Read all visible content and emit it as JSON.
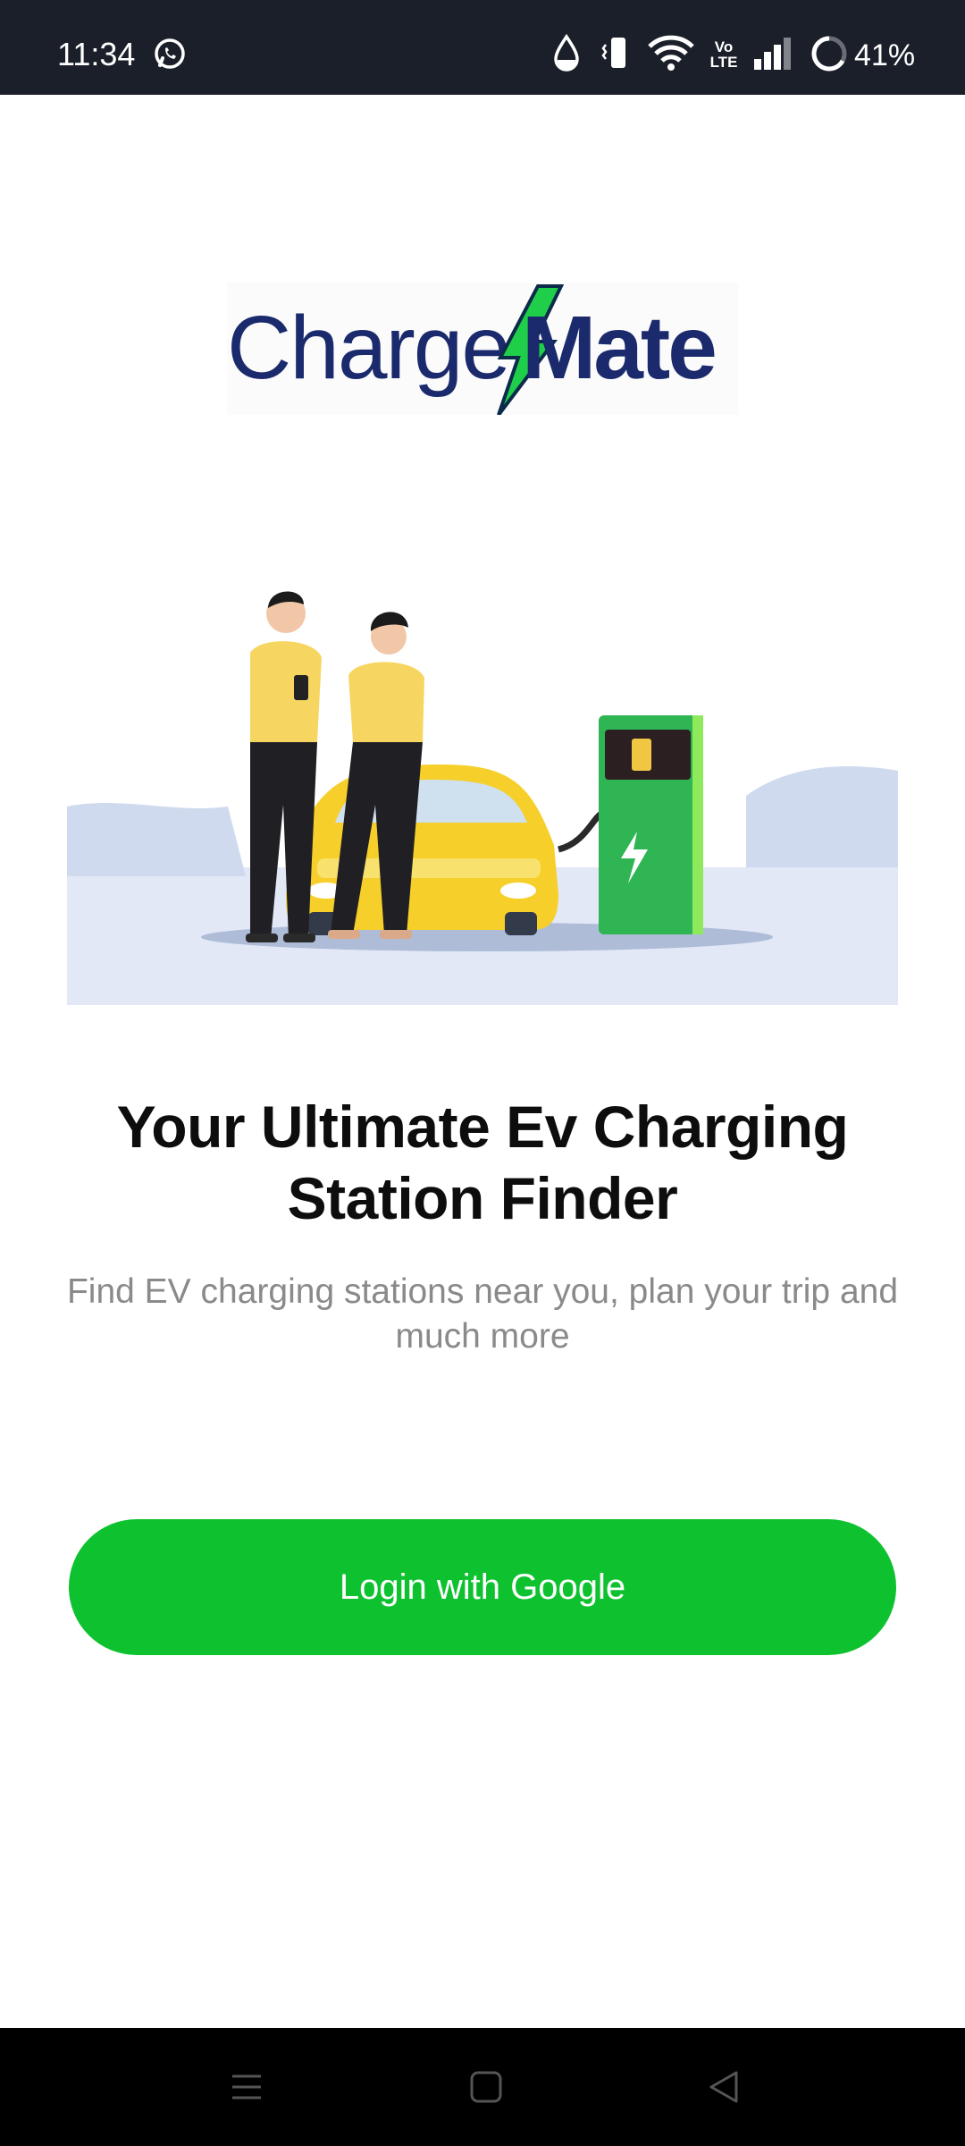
{
  "status_bar": {
    "time": "11:34",
    "battery": "41%",
    "icons": [
      "whatsapp-icon",
      "water-drop-icon",
      "vibrate-icon",
      "wifi-icon",
      "volte-icon",
      "signal-icon",
      "battery-ring-icon"
    ],
    "volte_label": "Vo LTE"
  },
  "logo": {
    "part1": "Charge",
    "part2": "Mate",
    "colors": {
      "text": "#1a2a6c",
      "bolt": "#1fcf4a"
    }
  },
  "hero": {
    "title": "Your Ultimate Ev Charging Station Finder",
    "subtitle": "Find EV charging stations near you, plan your trip and much more"
  },
  "login_button": {
    "label": "Login with Google",
    "color": "#0ec22f"
  },
  "nav_bar": {
    "icons": [
      "menu-icon",
      "home-square-icon",
      "back-triangle-icon"
    ]
  }
}
